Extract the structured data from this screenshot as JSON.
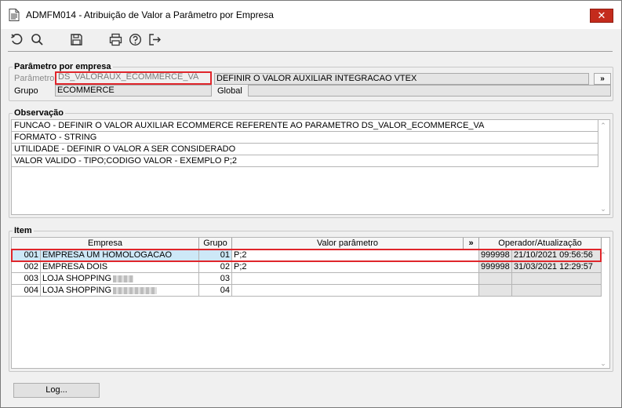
{
  "window": {
    "title": "ADMFM014 - Atribuição de Valor a Parâmetro por Empresa",
    "close_symbol": "✕"
  },
  "toolbar": {
    "icons": [
      "undo-icon",
      "search-icon",
      "save-icon",
      "print-icon",
      "help-icon",
      "exit-icon"
    ]
  },
  "parametro_group": {
    "legend": "Parâmetro por empresa",
    "parametro_label": "Parâmetro",
    "parametro_value": "DS_VALORAUX_ECOMMERCE_VA",
    "parametro_desc": "DEFINIR O VALOR AUXILIAR INTEGRACAO VTEX",
    "more_label": "»",
    "grupo_label": "Grupo",
    "grupo_value": "ECOMMERCE",
    "global_label": "Global",
    "global_value": ""
  },
  "observacao": {
    "legend": "Observação",
    "lines": [
      "FUNCAO - DEFINIR O VALOR AUXILIAR ECOMMERCE REFERENTE AO PARAMETRO DS_VALOR_ECOMMERCE_VA",
      "FORMATO - STRING",
      "UTILIDADE - DEFINIR O VALOR A SER CONSIDERADO",
      "VALOR VALIDO - TIPO;CODIGO VALOR - EXEMPLO P;2"
    ]
  },
  "item": {
    "legend": "Item",
    "headers": {
      "empresa": "Empresa",
      "grupo": "Grupo",
      "valor": "Valor parâmetro",
      "more": "»",
      "operador": "Operador/Atualização"
    },
    "rows": [
      {
        "cod": "001",
        "empresa": "EMPRESA UM HOMOLOGACAO",
        "grupo": "01",
        "valor": "P;2",
        "operador": "999998",
        "data": "21/10/2021 09:56:56"
      },
      {
        "cod": "002",
        "empresa": "EMPRESA DOIS",
        "grupo": "02",
        "valor": "P;2",
        "operador": "999998",
        "data": "31/03/2021 12:29:57"
      },
      {
        "cod": "003",
        "empresa": "LOJA SHOPPING",
        "grupo": "03",
        "valor": "",
        "operador": "",
        "data": ""
      },
      {
        "cod": "004",
        "empresa": "LOJA SHOPPING",
        "grupo": "04",
        "valor": "",
        "operador": "",
        "data": ""
      }
    ]
  },
  "footer": {
    "log_label": "Log..."
  },
  "colors": {
    "highlight": "#e0262b",
    "selection": "#cde8f7",
    "close": "#c42b1c"
  }
}
